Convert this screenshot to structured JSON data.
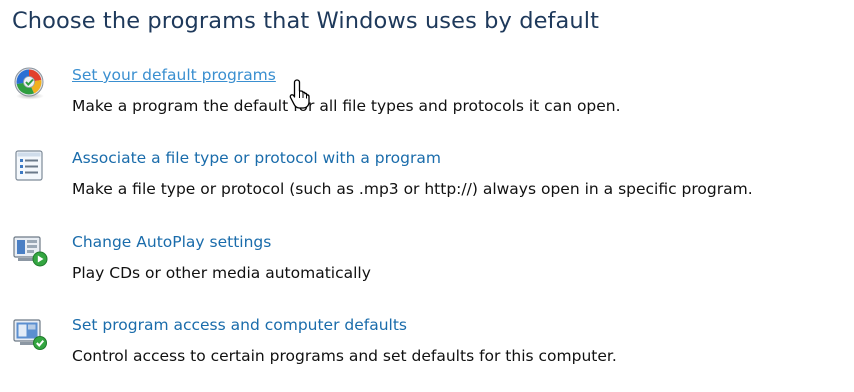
{
  "page_title": "Choose the programs that Windows uses by default",
  "items": [
    {
      "icon": "default-programs-icon",
      "link_label": "Set your default programs",
      "description": "Make a program the default for all file types and protocols it can open."
    },
    {
      "icon": "file-association-icon",
      "link_label": "Associate a file type or protocol with a program",
      "description": "Make a file type or protocol (such as .mp3 or http://) always open in a specific program."
    },
    {
      "icon": "autoplay-icon",
      "link_label": "Change AutoPlay settings",
      "description": "Play CDs or other media automatically"
    },
    {
      "icon": "program-access-icon",
      "link_label": "Set program access and computer defaults",
      "description": "Control access to certain programs and set defaults for this computer."
    }
  ],
  "cursor": "hand-pointer-cursor",
  "colors": {
    "title": "#1e395b",
    "link": "#1a6cab",
    "link_hover": "#3a8fd0",
    "text": "#111111"
  }
}
